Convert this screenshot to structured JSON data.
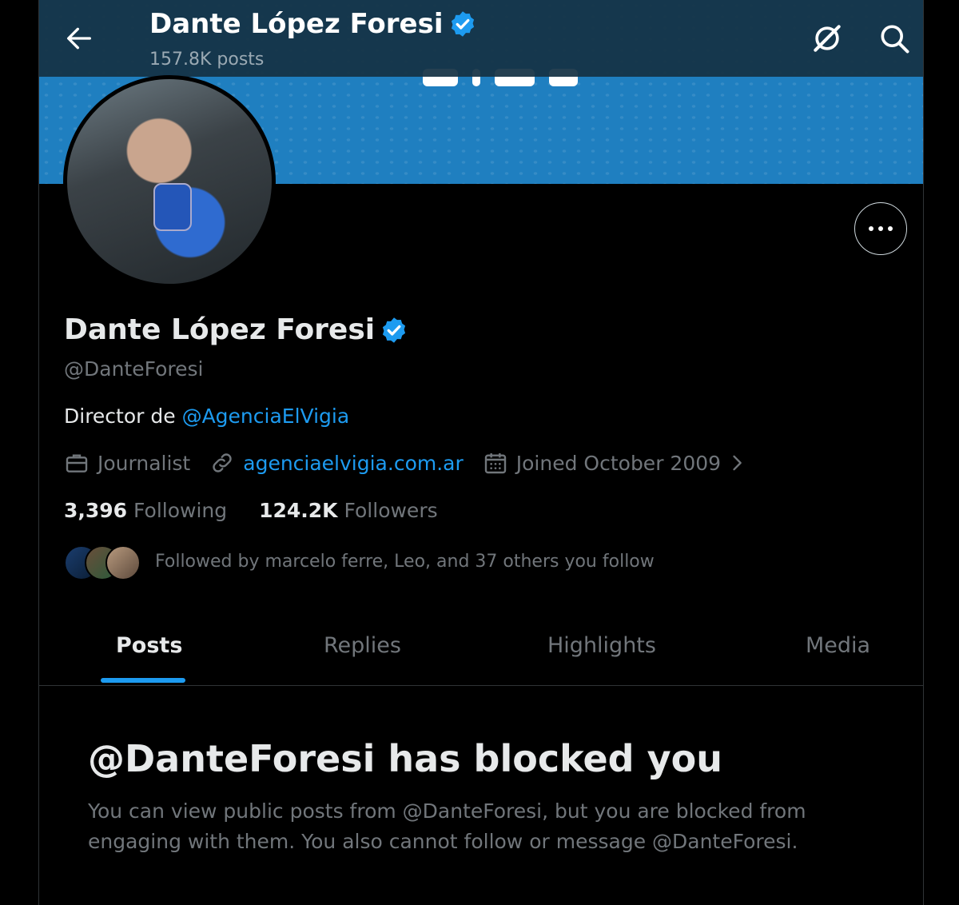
{
  "topbar": {
    "title": "Dante López Foresi",
    "posts_count": "157.8K posts"
  },
  "profile": {
    "name": "Dante López Foresi",
    "handle": "@DanteForesi",
    "bio_prefix": "Director de ",
    "bio_mention": "@AgenciaElVigia",
    "category": "Journalist",
    "website": "agenciaelvigia.com.ar",
    "joined": "Joined October 2009",
    "following_count": "3,396",
    "following_label": "Following",
    "followers_count": "124.2K",
    "followers_label": "Followers",
    "followed_by": "Followed by marcelo ferre, Leo, and 37 others you follow"
  },
  "tabs": [
    {
      "label": "Posts",
      "active": true
    },
    {
      "label": "Replies",
      "active": false
    },
    {
      "label": "Highlights",
      "active": false
    },
    {
      "label": "Media",
      "active": false
    }
  ],
  "blocked": {
    "title": "@DanteForesi has blocked you",
    "body": "You can view public posts from @DanteForesi, but you are blocked from engaging with them. You also cannot follow or message @DanteForesi."
  },
  "colors": {
    "accent": "#1d9bf0",
    "banner": "#1f7fc0",
    "background": "#000000",
    "muted_text": "#71767b"
  },
  "icons": [
    "back-arrow-icon",
    "verified-badge-icon",
    "grok-icon",
    "search-icon",
    "more-icon",
    "briefcase-icon",
    "link-icon",
    "calendar-icon",
    "chevron-right-icon"
  ]
}
